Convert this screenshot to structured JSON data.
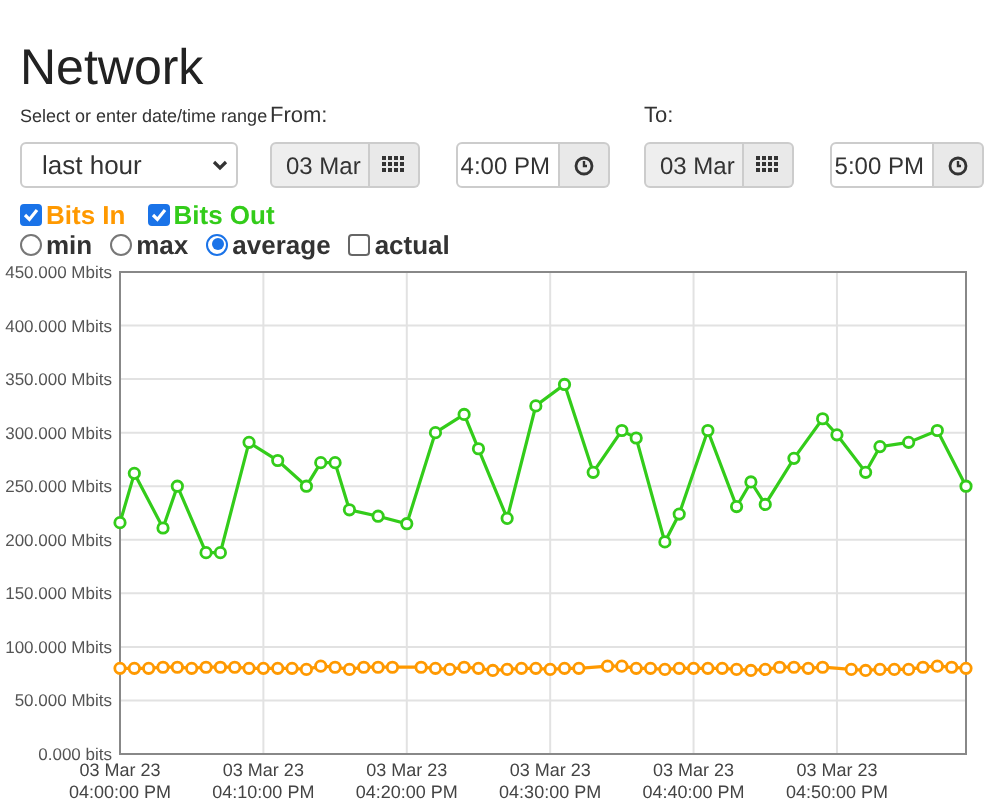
{
  "title": "Network",
  "range": {
    "label": "Select or enter date/time range",
    "value": "last hour"
  },
  "from": {
    "label": "From:",
    "date": "03 Mar",
    "date_disabled": true,
    "time": "4:00 PM"
  },
  "to": {
    "label": "To:",
    "date": "03 Mar",
    "date_disabled": true,
    "time": "5:00 PM"
  },
  "series_toggles": [
    {
      "checked": true
    },
    {
      "checked": true
    }
  ],
  "aggregation": [
    {
      "label": "min",
      "kind": "radio",
      "selected": false
    },
    {
      "label": "max",
      "kind": "radio",
      "selected": false
    },
    {
      "label": "average",
      "kind": "radio",
      "selected": true
    },
    {
      "label": "actual",
      "kind": "checkbox",
      "checked": false
    }
  ],
  "chart": {
    "chart_data": {
      "type": "line",
      "categories": [
        "03 Mar 23 04:00:00 PM",
        null,
        null,
        null,
        null,
        null,
        null,
        null,
        null,
        null,
        "03 Mar 23 04:10:00 PM",
        null,
        null,
        null,
        null,
        null,
        null,
        null,
        null,
        null,
        "03 Mar 23 04:20:00 PM",
        null,
        null,
        null,
        null,
        null,
        null,
        null,
        null,
        null,
        "03 Mar 23 04:30:00 PM",
        null,
        null,
        null,
        null,
        null,
        null,
        null,
        null,
        null,
        "03 Mar 23 04:40:00 PM",
        null,
        null,
        null,
        null,
        null,
        null,
        null,
        null,
        null,
        "03 Mar 23 04:50:00 PM",
        null,
        null,
        null,
        null,
        null,
        null,
        null,
        null,
        null
      ],
      "ylim": [
        0,
        450
      ],
      "grid": true,
      "yticks": [
        {
          "value": 0,
          "label": "0.000 bits"
        },
        {
          "value": 50,
          "label": "50.000 Mbits"
        },
        {
          "value": 100,
          "label": "100.000 Mbits"
        },
        {
          "value": 150,
          "label": "150.000 Mbits"
        },
        {
          "value": 200,
          "label": "200.000 Mbits"
        },
        {
          "value": 250,
          "label": "250.000 Mbits"
        },
        {
          "value": 300,
          "label": "300.000 Mbits"
        },
        {
          "value": 350,
          "label": "350.000 Mbits"
        },
        {
          "value": 400,
          "label": "400.000 Mbits"
        },
        {
          "value": 450,
          "label": "450.000 Mbits"
        }
      ],
      "series": [
        {
          "name": "Bits In",
          "color": "#ff9900",
          "marker": "circle",
          "values": [
            80,
            80,
            80,
            81,
            81,
            80,
            81,
            81,
            81,
            80,
            80,
            80,
            80,
            79,
            82,
            81,
            79,
            81,
            81,
            81,
            null,
            81,
            80,
            79,
            81,
            80,
            78,
            79,
            80,
            80,
            79,
            80,
            80,
            null,
            82,
            82,
            80,
            80,
            79,
            80,
            80,
            80,
            80,
            79,
            78,
            79,
            81,
            81,
            80,
            81,
            null,
            79,
            78,
            79,
            79,
            79,
            81,
            82,
            81,
            80
          ]
        },
        {
          "name": "Bits Out",
          "color": "#33cc1a",
          "marker": "circle",
          "values": [
            216,
            262,
            null,
            211,
            250,
            null,
            188,
            188,
            null,
            291,
            null,
            274,
            null,
            250,
            272,
            272,
            228,
            null,
            222,
            null,
            215,
            null,
            300,
            null,
            317,
            285,
            null,
            220,
            null,
            325,
            null,
            345,
            null,
            263,
            null,
            302,
            295,
            null,
            198,
            224,
            null,
            302,
            null,
            231,
            254,
            233,
            null,
            276,
            null,
            313,
            298,
            null,
            263,
            287,
            null,
            291,
            null,
            302,
            null,
            250
          ]
        }
      ]
    }
  }
}
